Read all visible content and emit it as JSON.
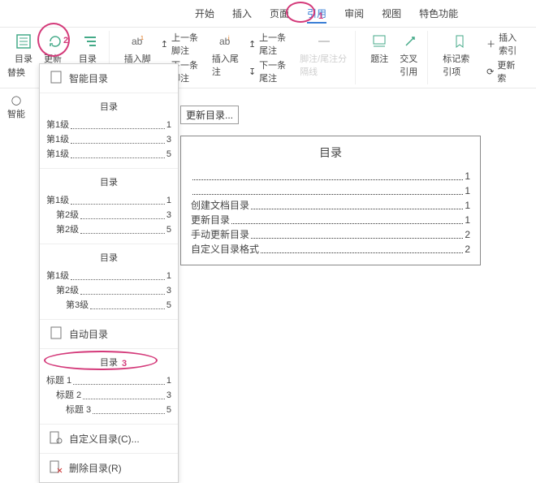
{
  "annotations": {
    "num1": "1",
    "num2": "2",
    "num3": "3"
  },
  "tabs": [
    "开始",
    "插入",
    "页面",
    "引用",
    "审阅",
    "视图",
    "特色功能"
  ],
  "active_tab_index": 3,
  "ribbon": {
    "toc": "目录",
    "update": "更新目录",
    "level": "目录级别",
    "foot_ins": "插入脚注",
    "foot_prev": "上一条脚注",
    "foot_next": "下一条脚注",
    "end_ins": "插入尾注",
    "end_prev": "上一条尾注",
    "end_next": "下一条尾注",
    "sep": "脚注/尾注分隔线",
    "cap": "题注",
    "xref": "交叉引用",
    "mark": "标记索引项",
    "ins_idx": "插入索引",
    "upd_idx": "更新索"
  },
  "sidebar": {
    "replace": "替换",
    "smart": "智能"
  },
  "dropdown": {
    "smart_toc": "智能目录",
    "auto_toc": "自动目录",
    "title": "目录",
    "custom": "自定义目录(C)...",
    "delete": "删除目录(R)",
    "block1": [
      {
        "t": "第1级",
        "n": "1",
        "ind": ""
      },
      {
        "t": "第1级",
        "n": "3",
        "ind": ""
      },
      {
        "t": "第1级",
        "n": "5",
        "ind": ""
      }
    ],
    "block2": [
      {
        "t": "第1级",
        "n": "1",
        "ind": ""
      },
      {
        "t": "第2级",
        "n": "3",
        "ind": "ind1"
      },
      {
        "t": "第2级",
        "n": "5",
        "ind": "ind1"
      }
    ],
    "block3": [
      {
        "t": "第1级",
        "n": "1",
        "ind": ""
      },
      {
        "t": "第2级",
        "n": "3",
        "ind": "ind1"
      },
      {
        "t": "第3级",
        "n": "5",
        "ind": "ind2"
      }
    ],
    "block4": [
      {
        "t": "标题 1",
        "n": "1",
        "ind": ""
      },
      {
        "t": "标题 2",
        "n": "3",
        "ind": "ind1"
      },
      {
        "t": "标题 3",
        "n": "5",
        "ind": "ind2"
      }
    ]
  },
  "doc": {
    "hint": "更新目录...",
    "title": "目录",
    "rows": [
      {
        "t": "",
        "n": "1"
      },
      {
        "t": "",
        "n": "1"
      },
      {
        "t": "创建文档目录",
        "n": "1"
      },
      {
        "t": "更新目录",
        "n": "1"
      },
      {
        "t": "手动更新目录",
        "n": "2"
      },
      {
        "t": "自定义目录格式",
        "n": "2"
      }
    ]
  }
}
